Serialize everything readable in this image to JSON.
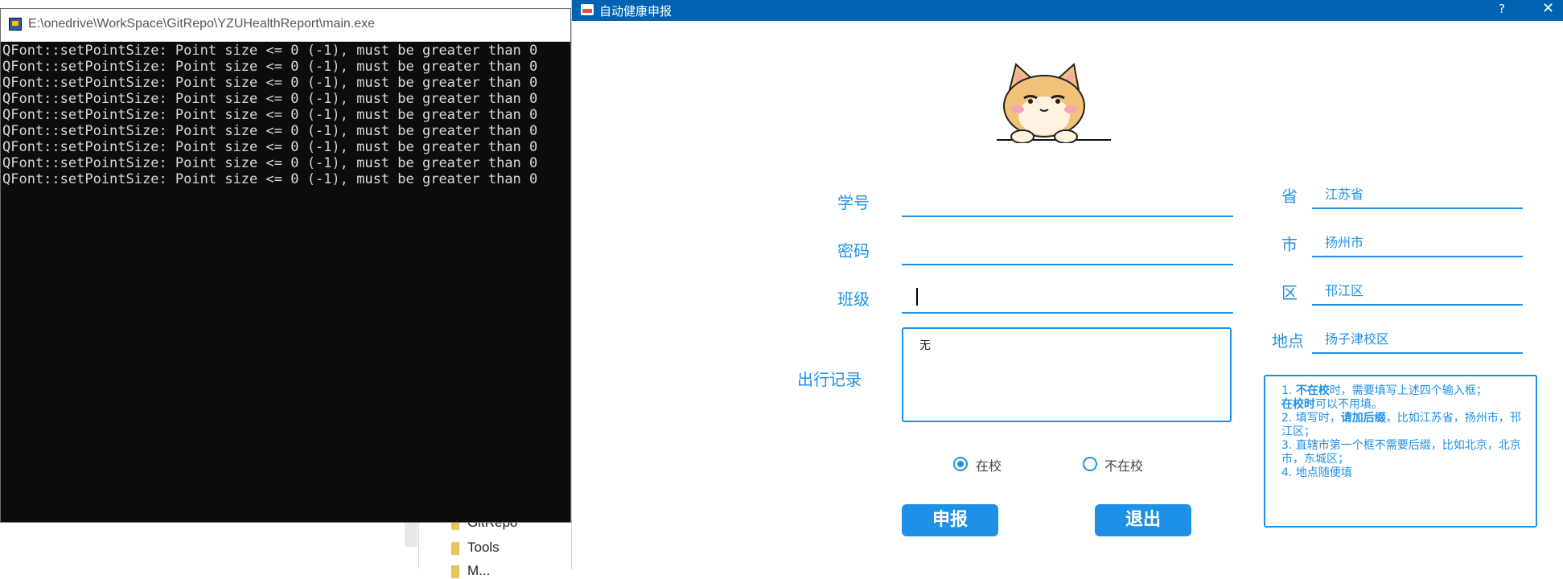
{
  "explorer": {
    "items": [
      {
        "label": "GitRepo"
      },
      {
        "label": "Tools"
      },
      {
        "label": "M..."
      }
    ]
  },
  "console": {
    "title": "E:\\onedrive\\WorkSpace\\GitRepo\\YZUHealthReport\\main.exe",
    "lines": [
      "QFont::setPointSize: Point size <= 0 (-1), must be greater than 0",
      "QFont::setPointSize: Point size <= 0 (-1), must be greater than 0",
      "QFont::setPointSize: Point size <= 0 (-1), must be greater than 0",
      "QFont::setPointSize: Point size <= 0 (-1), must be greater than 0",
      "QFont::setPointSize: Point size <= 0 (-1), must be greater than 0",
      "QFont::setPointSize: Point size <= 0 (-1), must be greater than 0",
      "QFont::setPointSize: Point size <= 0 (-1), must be greater than 0",
      "QFont::setPointSize: Point size <= 0 (-1), must be greater than 0",
      "QFont::setPointSize: Point size <= 0 (-1), must be greater than 0"
    ]
  },
  "dialog": {
    "title": "自动健康申报",
    "help": "?",
    "close": "✕",
    "accent": "#1e90e8",
    "titlebar_color": "#0063b1",
    "form": {
      "student_id_label": "学号",
      "student_id_value": "",
      "password_label": "密码",
      "password_value": "",
      "class_label": "班级",
      "class_value": "",
      "travel_label": "出行记录",
      "travel_value": "无",
      "province_label": "省",
      "province_value": "江苏省",
      "city_label": "市",
      "city_value": "扬州市",
      "district_label": "区",
      "district_value": "邗江区",
      "location_label": "地点",
      "location_value": "扬子津校区"
    },
    "radios": {
      "on_campus": {
        "label": "在校",
        "checked": true
      },
      "off_campus": {
        "label": "不在校",
        "checked": false
      }
    },
    "buttons": {
      "submit": "申报",
      "exit": "退出"
    },
    "info": {
      "l1_num": "1. ",
      "l1_bold": "不在校",
      "l1_rest": "时，需要填写上述四个输入框；",
      "l2_bold": "在校时",
      "l2_rest": "可以不用填。",
      "l3_num": "2. 填写时，",
      "l3_bold": "请加后缀",
      "l3_rest": "，比如江苏省，扬州市，邗江区；",
      "l4": "3. 直辖市第一个框不需要后缀，比如北京，北京市，东城区；",
      "l5": "4. 地点随便填"
    }
  }
}
